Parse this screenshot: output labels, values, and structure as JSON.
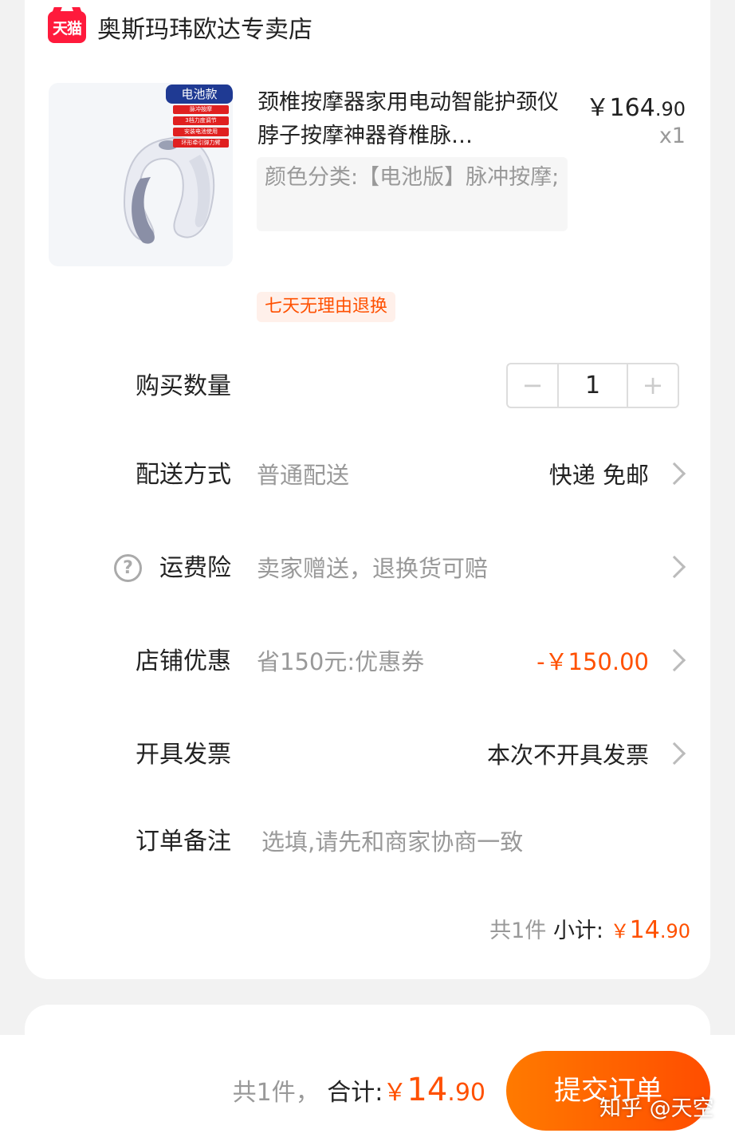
{
  "shop": {
    "logo_text": "天猫",
    "name": "奥斯玛玮欧达专卖店"
  },
  "product": {
    "image_tag": "电池款",
    "image_features": [
      "脉冲按摩",
      "3档力度调节",
      "安装电池使用",
      "环形牵引弹力臂"
    ],
    "title": "颈椎按摩器家用电动智能护颈仪脖子按摩神器脊椎脉…",
    "price_main": "￥164",
    "price_decimal": ".90",
    "quantity_label": "x1",
    "spec": "颜色分类:【电池版】脉冲按摩;",
    "badge": "七天无理由退换"
  },
  "quantity": {
    "label": "购买数量",
    "minus": "−",
    "value": "1",
    "plus": "+"
  },
  "delivery": {
    "label": "配送方式",
    "desc": "普通配送",
    "value": "快递 免邮"
  },
  "insurance": {
    "icon": "?",
    "label": "运费险",
    "desc": "卖家赠送，退换货可赔"
  },
  "coupon": {
    "label": "店铺优惠",
    "desc": "省150元:优惠券",
    "value": "-￥150.00"
  },
  "invoice": {
    "label": "开具发票",
    "value": "本次不开具发票"
  },
  "note": {
    "label": "订单备注",
    "placeholder": "选填,请先和商家协商一致"
  },
  "subtotal": {
    "count": "共1件",
    "label": "小计:",
    "currency": "￥",
    "main": "14",
    "decimal": ".90"
  },
  "footer": {
    "count": "共1件，",
    "label": "合计:",
    "currency": "￥",
    "main": "14",
    "decimal": ".90",
    "submit": "提交订单",
    "watermark": "知乎 @天空"
  },
  "colors": {
    "accent": "#ff5000",
    "tmall_red": "#ff1a3c"
  }
}
